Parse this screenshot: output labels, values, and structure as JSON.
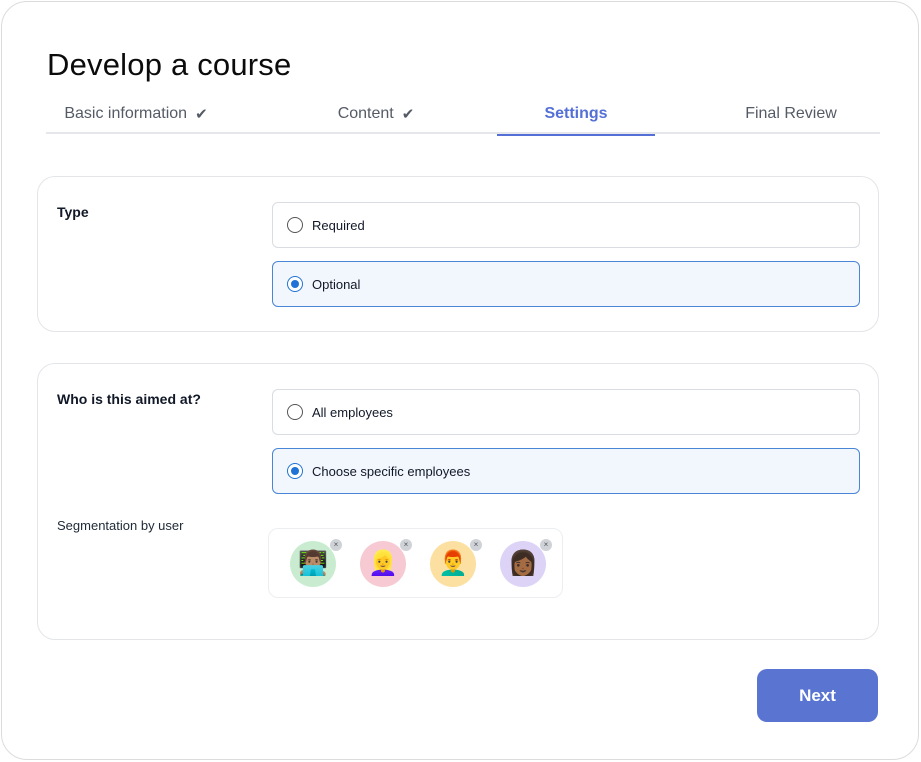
{
  "page": {
    "title": "Develop a course"
  },
  "tabs": [
    {
      "label": "Basic information",
      "completed": true,
      "active": false
    },
    {
      "label": "Content",
      "completed": true,
      "active": false
    },
    {
      "label": "Settings",
      "completed": false,
      "active": true
    },
    {
      "label": "Final Review",
      "completed": false,
      "active": false
    }
  ],
  "check_glyph": "✔",
  "type_section": {
    "label": "Type",
    "options": [
      {
        "label": "Required",
        "selected": false
      },
      {
        "label": "Optional",
        "selected": true
      }
    ]
  },
  "audience_section": {
    "label": "Who is this aimed at?",
    "options": [
      {
        "label": "All employees",
        "selected": false
      },
      {
        "label": "Choose specific employees",
        "selected": true
      }
    ],
    "segmentation_label": "Segmentation by user",
    "avatars": [
      {
        "icon": "man-technologist-icon",
        "emoji": "👨🏽‍💻",
        "bg": "#c9ecd0"
      },
      {
        "icon": "woman-blond-icon",
        "emoji": "👱‍♀️",
        "bg": "#f7c9d2"
      },
      {
        "icon": "man-red-hair-icon",
        "emoji": "👨‍🦰",
        "bg": "#fbe0a1"
      },
      {
        "icon": "woman-dark-skin-icon",
        "emoji": "👩🏾",
        "bg": "#dcd3f7"
      }
    ],
    "remove_glyph": "×"
  },
  "footer": {
    "next_label": "Next"
  },
  "colors": {
    "accent": "#5470d6",
    "button": "#5a74d1",
    "radio": "#1f73d6"
  }
}
